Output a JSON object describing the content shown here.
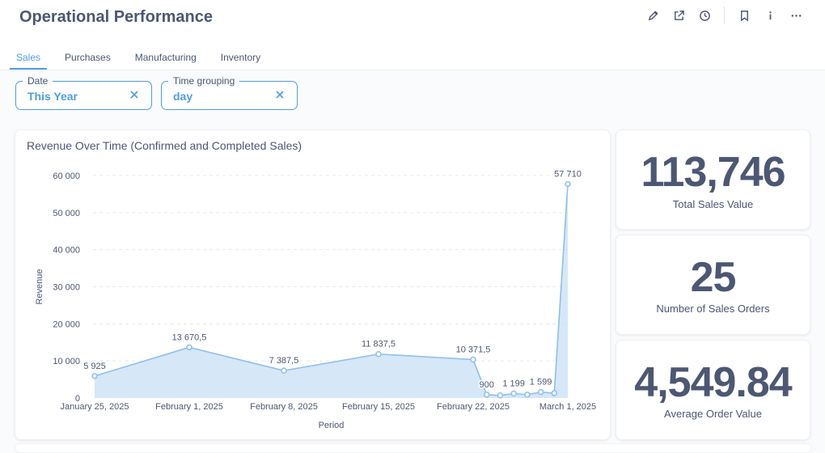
{
  "page": {
    "title": "Operational Performance"
  },
  "header_actions": [
    "edit-icon",
    "share-icon",
    "history-icon",
    "bookmark-icon",
    "info-icon",
    "more-icon"
  ],
  "tabs": [
    {
      "label": "Sales",
      "active": true
    },
    {
      "label": "Purchases",
      "active": false
    },
    {
      "label": "Manufacturing",
      "active": false
    },
    {
      "label": "Inventory",
      "active": false
    }
  ],
  "filters": [
    {
      "label": "Date",
      "value": "This Year"
    },
    {
      "label": "Time grouping",
      "value": "day"
    }
  ],
  "chart": {
    "title": "Revenue Over Time (Confirmed and Completed Sales)"
  },
  "chart_data": {
    "type": "area",
    "title": "Revenue Over Time (Confirmed and Completed Sales)",
    "xlabel": "Period",
    "ylabel": "Revenue",
    "ylim": [
      0,
      60000
    ],
    "xlim": [
      "2025-01-25",
      "2025-03-01"
    ],
    "yticks": [
      "0",
      "10 000",
      "20 000",
      "30 000",
      "40 000",
      "50 000",
      "60 000"
    ],
    "xticks": [
      "January 25, 2025",
      "February 1, 2025",
      "February 8, 2025",
      "February 15, 2025",
      "February 22, 2025",
      "March 1, 2025"
    ],
    "grid": true,
    "color": "#509ee3",
    "series": [
      {
        "points": [
          {
            "x": "2025-01-25",
            "y": 5925,
            "label": "5 925"
          },
          {
            "x": "2025-02-01",
            "y": 13670.5,
            "label": "13 670,5"
          },
          {
            "x": "2025-02-08",
            "y": 7387.5,
            "label": "7 387,5"
          },
          {
            "x": "2025-02-15",
            "y": 11837.5,
            "label": "11 837,5"
          },
          {
            "x": "2025-02-22",
            "y": 10371.5,
            "label": "10 371,5"
          },
          {
            "x": "2025-02-23",
            "y": 900,
            "label": "900"
          },
          {
            "x": "2025-02-24",
            "y": 700,
            "label": ""
          },
          {
            "x": "2025-02-25",
            "y": 1199,
            "label": "1 199"
          },
          {
            "x": "2025-02-26",
            "y": 900,
            "label": ""
          },
          {
            "x": "2025-02-27",
            "y": 1599,
            "label": "1 599"
          },
          {
            "x": "2025-02-28",
            "y": 1300,
            "label": ""
          },
          {
            "x": "2025-03-01",
            "y": 57710,
            "label": "57 710"
          }
        ]
      }
    ]
  },
  "scalars": [
    {
      "value": "113,746",
      "label": "Total Sales Value"
    },
    {
      "value": "25",
      "label": "Number of Sales Orders"
    },
    {
      "value": "4,549.84",
      "label": "Average Order Value"
    }
  ]
}
